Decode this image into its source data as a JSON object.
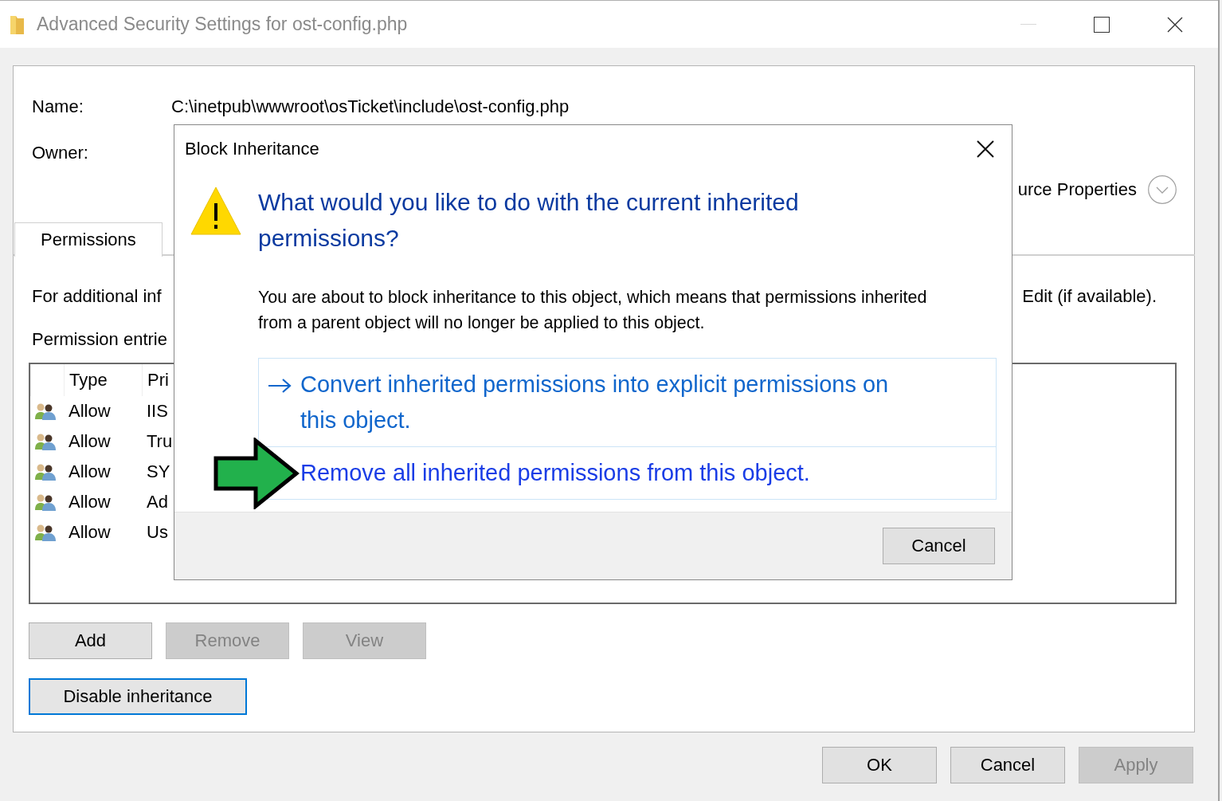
{
  "window": {
    "title": "Advanced Security Settings for ost-config.php"
  },
  "details": [
    {
      "label": "Name:",
      "value": "C:\\inetpub\\wwwroot\\osTicket\\include\\ost-config.php"
    },
    {
      "label": "Owner:"
    }
  ],
  "properties_link": "urce Properties",
  "tabs": [
    {
      "label": "Permissions",
      "selected": true
    }
  ],
  "info_text_left": "For additional inf",
  "info_text_right": "Edit (if available).",
  "entries_label": "Permission entrie",
  "table": {
    "columns": [
      "Type",
      "Pri"
    ],
    "rows": [
      {
        "type": "Allow",
        "principal": "IIS"
      },
      {
        "type": "Allow",
        "principal": "Tru"
      },
      {
        "type": "Allow",
        "principal": "SY"
      },
      {
        "type": "Allow",
        "principal": "Ad"
      },
      {
        "type": "Allow",
        "principal": "Us"
      }
    ]
  },
  "entry_buttons": [
    {
      "label": "Add",
      "disabled": false
    },
    {
      "label": "Remove",
      "disabled": true
    },
    {
      "label": "View",
      "disabled": true
    }
  ],
  "inheritance_button": {
    "label": "Disable inheritance",
    "focused": true
  },
  "footer_buttons": [
    {
      "label": "OK",
      "disabled": false
    },
    {
      "label": "Cancel",
      "disabled": false
    },
    {
      "label": "Apply",
      "disabled": true
    }
  ],
  "dialog": {
    "title": "Block Inheritance",
    "heading": "What would you like to do with the current inherited permissions?",
    "message": "You are about to block inheritance to this object, which means that permissions inherited from a parent object will no longer be applied to this object.",
    "links": [
      {
        "text": "Convert inherited permissions into explicit permissions on this object.",
        "hovered": false,
        "icon": true
      },
      {
        "text": "Remove all inherited permissions from this object.",
        "hovered": true,
        "icon": false
      }
    ],
    "cancel": "Cancel"
  }
}
